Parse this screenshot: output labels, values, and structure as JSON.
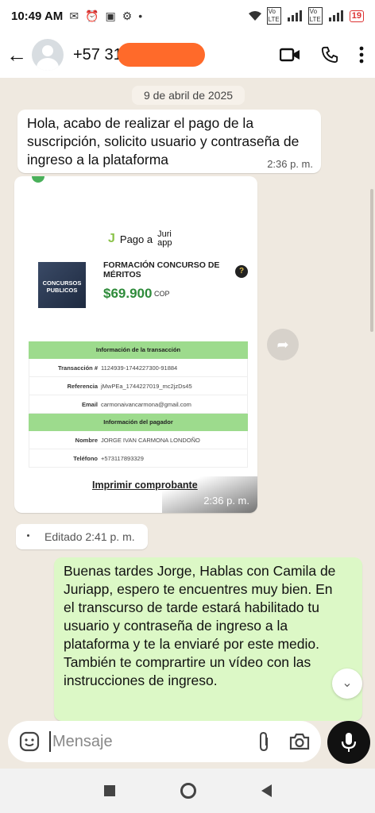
{
  "status": {
    "time": "10:49 AM",
    "battery": "19"
  },
  "header": {
    "contact_visible": "+57 31"
  },
  "chat": {
    "date_chip": "9 de abril de 2025",
    "msg1": {
      "text": "Hola, acabo de realizar el pago de la suscripción, solicito usuario y contraseña de ingreso a la plataforma",
      "time": "2:36 p. m."
    },
    "receipt": {
      "brand_prefix": "Pago a",
      "brand_logo_line1": "Juri",
      "brand_logo_line2": "app",
      "product_image_text": "CONCURSOS PUBLICOS",
      "product_title": "FORMACIÓN CONCURSO DE MÉRITOS",
      "price": "$69.900",
      "currency": "COP",
      "section1_title": "Información de la transacción",
      "section1_rows": [
        {
          "k": "Transacción #",
          "v": "1124939-1744227300-91884"
        },
        {
          "k": "Referencia",
          "v": "jMwPEa_1744227019_mc2jzDs45"
        },
        {
          "k": "Email",
          "v": "carmonaivancarmona@gmail.com"
        }
      ],
      "section2_title": "Información del pagador",
      "section2_rows": [
        {
          "k": "Nombre",
          "v": "JORGE IVAN CARMONA LONDOÑO"
        },
        {
          "k": "Teléfono",
          "v": "+573117893329"
        }
      ],
      "print_label": "Imprimir comprobante",
      "time": "2:36 p. m."
    },
    "edited": "Editado 2:41 p. m.",
    "msg_out": {
      "text": "Buenas tardes Jorge, Hablas con Camila de Juriapp, espero te encuentres muy bien. En el transcurso de tarde estará habilitado tu usuario y contraseña de ingreso a la plataforma y te la enviaré por este medio. También te comprartire un vídeo con las instrucciones de ingreso."
    }
  },
  "input": {
    "placeholder": "Mensaje"
  },
  "icons": [
    "back-arrow-icon",
    "video-call-icon",
    "phone-icon",
    "more-vert-icon",
    "forward-icon",
    "chevron-down-icon",
    "sticker-icon",
    "attach-icon",
    "camera-icon",
    "mic-icon"
  ]
}
